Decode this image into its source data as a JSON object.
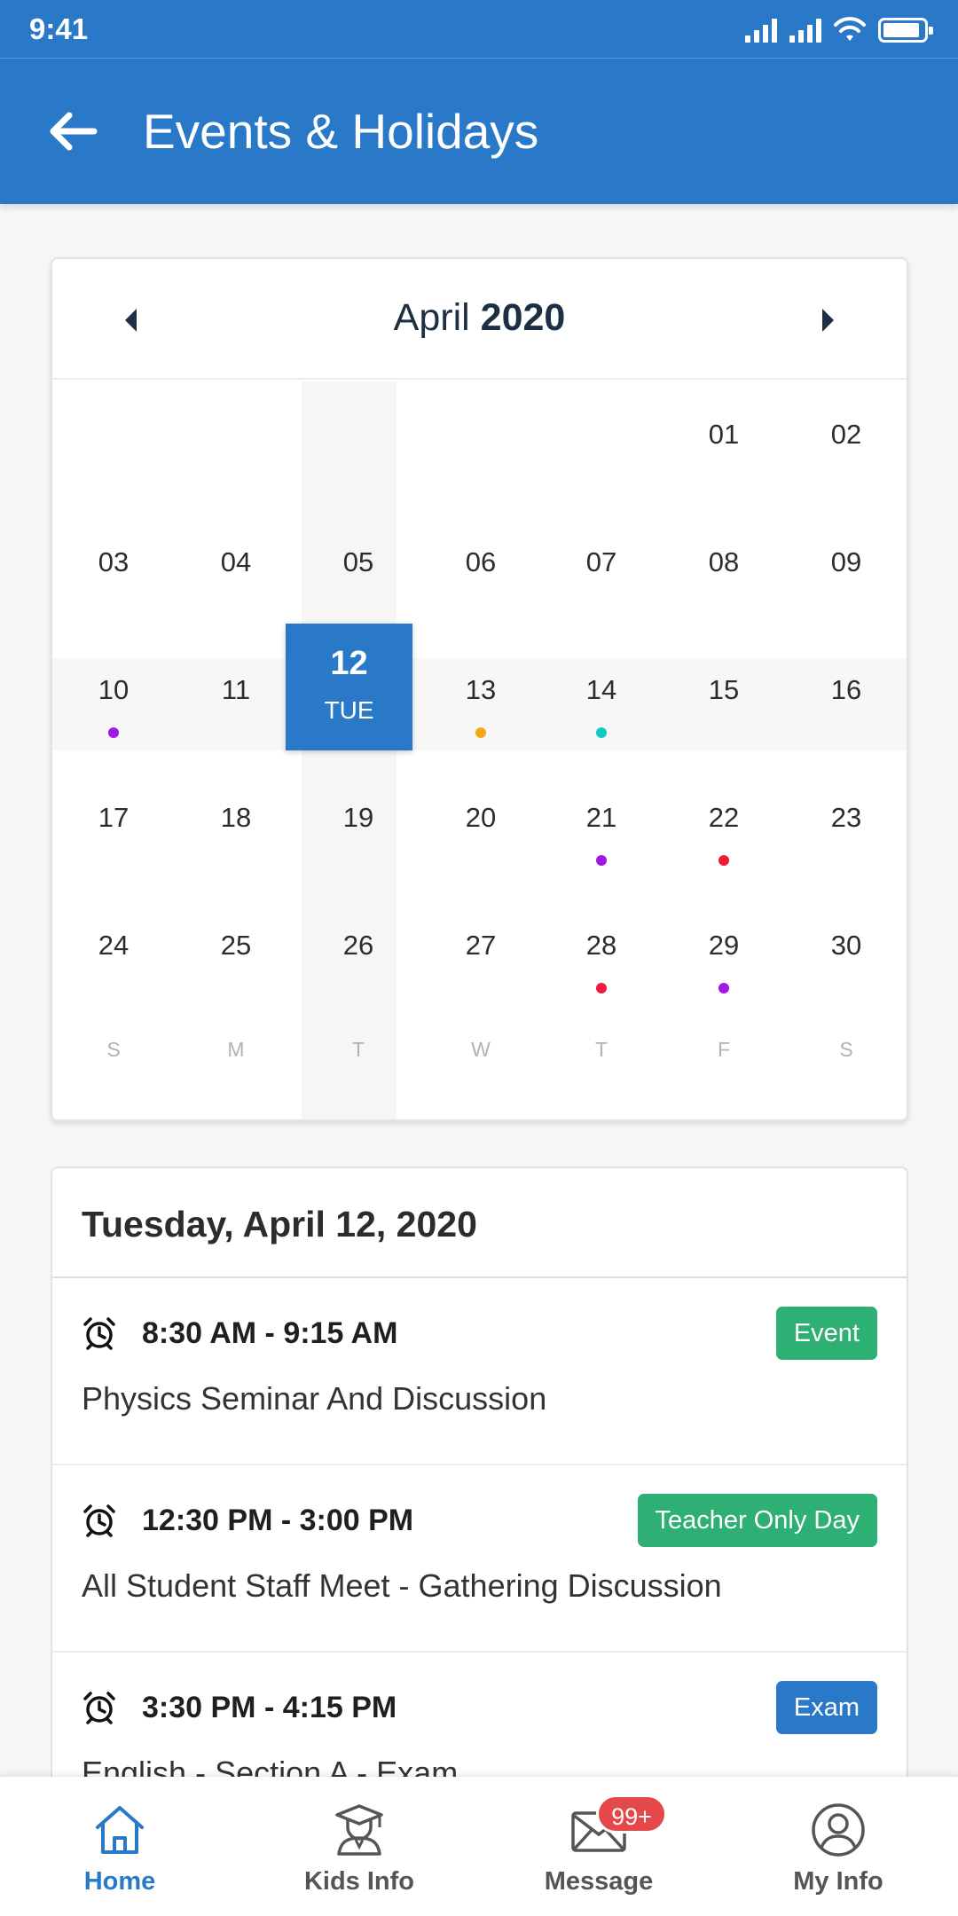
{
  "status_bar": {
    "time": "9:41"
  },
  "app_bar": {
    "title": "Events & Holidays"
  },
  "calendar": {
    "month": "April",
    "year": "2020",
    "selected": {
      "day": "12",
      "weekday": "TUE"
    },
    "weekdays": [
      "S",
      "M",
      "T",
      "W",
      "T",
      "F",
      "S"
    ],
    "weeks": [
      [
        {
          "day": ""
        },
        {
          "day": ""
        },
        {
          "day": ""
        },
        {
          "day": ""
        },
        {
          "day": ""
        },
        {
          "day": "01"
        },
        {
          "day": "02"
        }
      ],
      [
        {
          "day": "03"
        },
        {
          "day": "04"
        },
        {
          "day": "05"
        },
        {
          "day": "06"
        },
        {
          "day": "07"
        },
        {
          "day": "08"
        },
        {
          "day": "09"
        }
      ],
      [
        {
          "day": "10",
          "dot": "#a019e0"
        },
        {
          "day": "11"
        },
        {
          "day": "12",
          "selected": true
        },
        {
          "day": "13",
          "dot": "#f2a817"
        },
        {
          "day": "14",
          "dot": "#17c8c0"
        },
        {
          "day": "15"
        },
        {
          "day": "16"
        }
      ],
      [
        {
          "day": "17"
        },
        {
          "day": "18"
        },
        {
          "day": "19"
        },
        {
          "day": "20"
        },
        {
          "day": "21",
          "dot": "#a019e0"
        },
        {
          "day": "22",
          "dot": "#ee1b3d"
        },
        {
          "day": "23"
        }
      ],
      [
        {
          "day": "24"
        },
        {
          "day": "25"
        },
        {
          "day": "26"
        },
        {
          "day": "27"
        },
        {
          "day": "28",
          "dot": "#ee1b3d"
        },
        {
          "day": "29",
          "dot": "#a019e0"
        },
        {
          "day": "30"
        }
      ]
    ]
  },
  "events": {
    "date_heading": "Tuesday, April 12, 2020",
    "items": [
      {
        "time": "8:30 AM - 9:15 AM",
        "title": "Physics Seminar And Discussion",
        "badge": "Event",
        "badge_color": "#2eaf74"
      },
      {
        "time": "12:30 PM - 3:00 PM",
        "title": "All Student Staff Meet - Gathering Discussion",
        "badge": "Teacher Only Day",
        "badge_color": "#2eaf74"
      },
      {
        "time": "3:30 PM - 4:15 PM",
        "title": "English - Section A - Exam",
        "badge": "Exam",
        "badge_color": "#2a79c9"
      }
    ]
  },
  "bottom_nav": {
    "items": [
      {
        "label": "Home",
        "icon": "home-icon",
        "active": true
      },
      {
        "label": "Kids Info",
        "icon": "graduate-icon",
        "active": false
      },
      {
        "label": "Message",
        "icon": "mail-icon",
        "active": false,
        "badge": "99+"
      },
      {
        "label": "My Info",
        "icon": "user-icon",
        "active": false
      }
    ]
  },
  "colors": {
    "primary": "#2a79c9",
    "success": "#2eaf74",
    "alert": "#e54848"
  }
}
